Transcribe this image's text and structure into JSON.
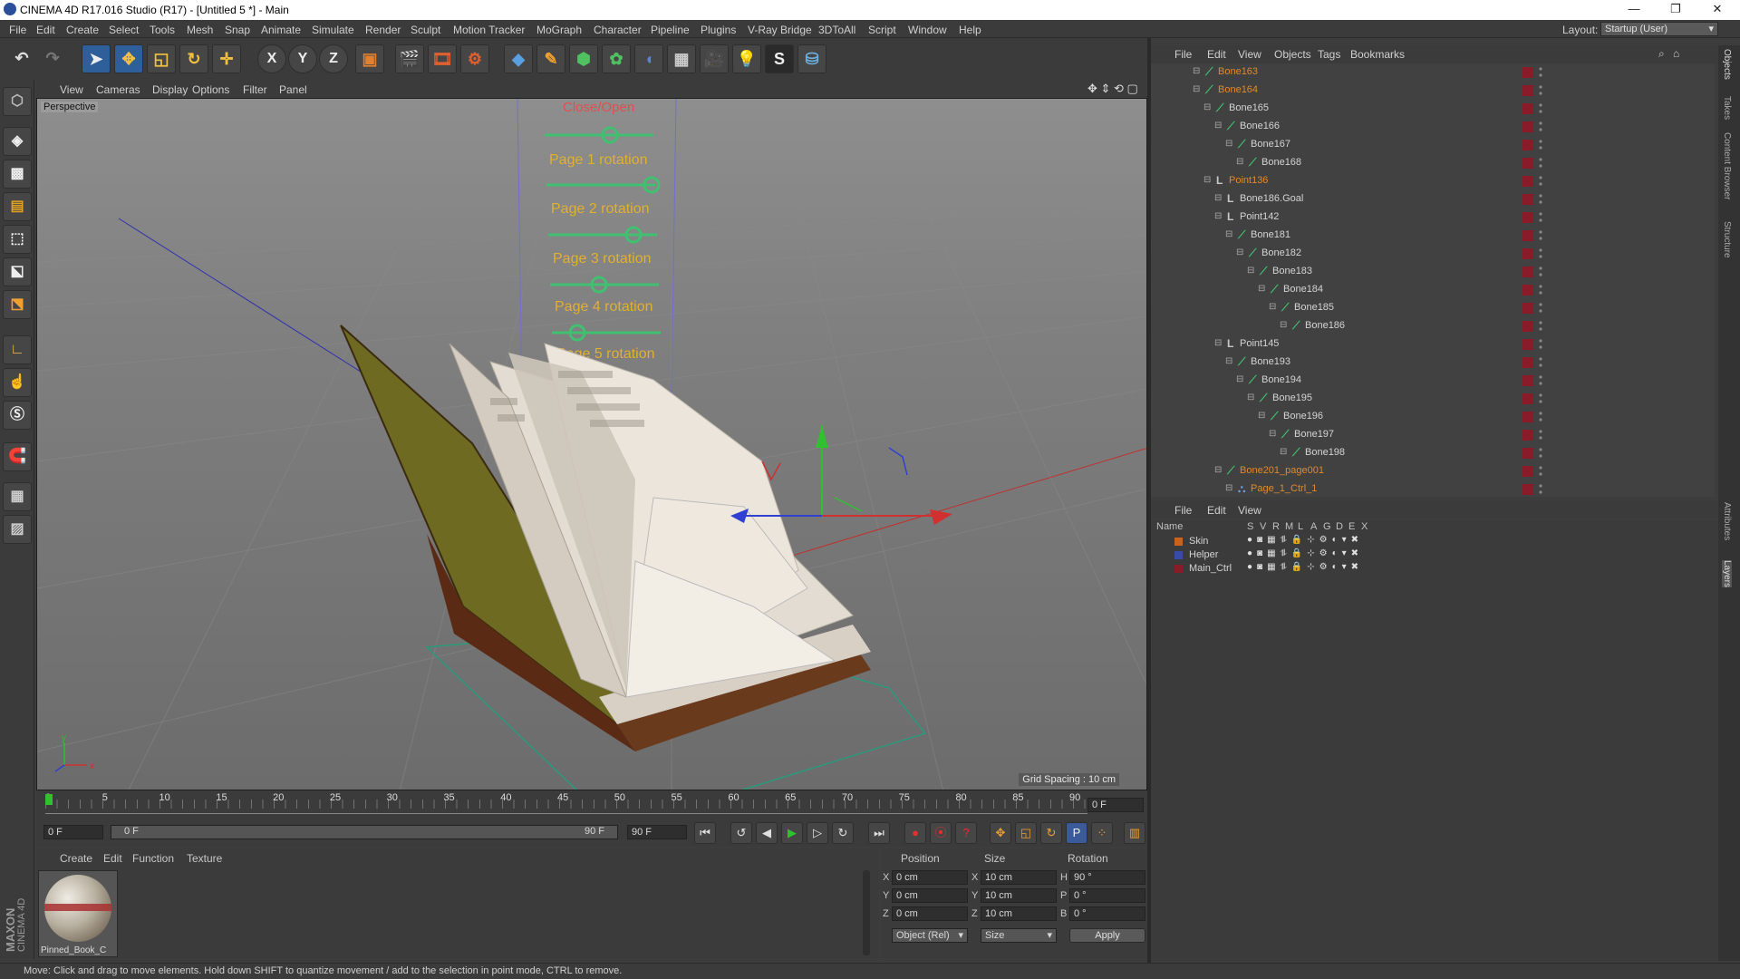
{
  "window": {
    "title": "CINEMA 4D R17.016 Studio (R17) - [Untitled 5 *] - Main",
    "controls": [
      "—",
      "❐",
      "✕"
    ]
  },
  "menubar": {
    "items": [
      "File",
      "Edit",
      "Create",
      "Select",
      "Tools",
      "Mesh",
      "Snap",
      "Animate",
      "Simulate",
      "Render",
      "Sculpt",
      "Motion Tracker",
      "MoGraph",
      "Character",
      "Pipeline",
      "Plugins",
      "V-Ray Bridge",
      "3DToAll",
      "Script",
      "Window",
      "Help"
    ],
    "layout_label": "Layout:",
    "layout_value": "Startup (User)"
  },
  "toolbar": {
    "axis_labels": [
      "X",
      "Y",
      "Z"
    ]
  },
  "viewport": {
    "menu": [
      "View",
      "Cameras",
      "Display",
      "Options",
      "Filter",
      "Panel"
    ],
    "label": "Perspective",
    "grid_spacing": "Grid Spacing : 10 cm",
    "rig_labels": [
      "Close/Open",
      "Page 1 rotation",
      "Page 2 rotation",
      "Page 3 rotation",
      "Page 4 rotation",
      "Page 5 rotation"
    ],
    "axis_x": "x",
    "axis_y": "y"
  },
  "timeline": {
    "ticks": [
      "0",
      "5",
      "10",
      "15",
      "20",
      "25",
      "30",
      "35",
      "40",
      "45",
      "50",
      "55",
      "60",
      "65",
      "70",
      "75",
      "80",
      "85",
      "90"
    ],
    "current_frame": "0 F",
    "playhead_fraction": 0.0
  },
  "playback": {
    "start_field": "0 F",
    "range_start": "0 F",
    "range_end": "90 F",
    "end_field": "90 F"
  },
  "material_manager": {
    "menu": [
      "Create",
      "Edit",
      "Function",
      "Texture"
    ],
    "material_name": "Pinned_Book_C"
  },
  "coordinates": {
    "headers": [
      "Position",
      "Size",
      "Rotation"
    ],
    "rows": [
      {
        "axis": "X",
        "pos": "0 cm",
        "size_axis": "X",
        "size": "10 cm",
        "rot_axis": "H",
        "rot": "90 °"
      },
      {
        "axis": "Y",
        "pos": "0 cm",
        "size_axis": "Y",
        "size": "10 cm",
        "rot_axis": "P",
        "rot": "0 °"
      },
      {
        "axis": "Z",
        "pos": "0 cm",
        "size_axis": "Z",
        "size": "10 cm",
        "rot_axis": "B",
        "rot": "0 °"
      }
    ],
    "mode": "Object (Rel)",
    "size_mode": "Size",
    "apply": "Apply"
  },
  "object_manager": {
    "menu": [
      "File",
      "Edit",
      "View",
      "Objects",
      "Tags",
      "Bookmarks"
    ],
    "objects": [
      {
        "name": "Bone163",
        "orange": true,
        "depth": 3,
        "type": "bone"
      },
      {
        "name": "Bone164",
        "orange": true,
        "depth": 3,
        "type": "bone"
      },
      {
        "name": "Bone165",
        "orange": false,
        "depth": 4,
        "type": "bone"
      },
      {
        "name": "Bone166",
        "orange": false,
        "depth": 5,
        "type": "bone"
      },
      {
        "name": "Bone167",
        "orange": false,
        "depth": 6,
        "type": "bone"
      },
      {
        "name": "Bone168",
        "orange": false,
        "depth": 7,
        "type": "bone"
      },
      {
        "name": "Point136",
        "orange": true,
        "depth": 4,
        "type": "null"
      },
      {
        "name": "Bone186.Goal",
        "orange": false,
        "depth": 5,
        "type": "null"
      },
      {
        "name": "Point142",
        "orange": false,
        "depth": 5,
        "type": "null"
      },
      {
        "name": "Bone181",
        "orange": false,
        "depth": 6,
        "type": "bone"
      },
      {
        "name": "Bone182",
        "orange": false,
        "depth": 7,
        "type": "bone"
      },
      {
        "name": "Bone183",
        "orange": false,
        "depth": 8,
        "type": "bone"
      },
      {
        "name": "Bone184",
        "orange": false,
        "depth": 9,
        "type": "bone"
      },
      {
        "name": "Bone185",
        "orange": false,
        "depth": 10,
        "type": "bone"
      },
      {
        "name": "Bone186",
        "orange": false,
        "depth": 11,
        "type": "bone"
      },
      {
        "name": "Point145",
        "orange": false,
        "depth": 5,
        "type": "null"
      },
      {
        "name": "Bone193",
        "orange": false,
        "depth": 6,
        "type": "bone"
      },
      {
        "name": "Bone194",
        "orange": false,
        "depth": 7,
        "type": "bone"
      },
      {
        "name": "Bone195",
        "orange": false,
        "depth": 8,
        "type": "bone"
      },
      {
        "name": "Bone196",
        "orange": false,
        "depth": 9,
        "type": "bone"
      },
      {
        "name": "Bone197",
        "orange": false,
        "depth": 10,
        "type": "bone"
      },
      {
        "name": "Bone198",
        "orange": false,
        "depth": 11,
        "type": "bone"
      },
      {
        "name": "Bone201_page001",
        "orange": true,
        "depth": 5,
        "type": "bone"
      },
      {
        "name": "Page_1_Ctrl_1",
        "orange": true,
        "depth": 6,
        "type": "ctrl"
      }
    ]
  },
  "layer_manager": {
    "menu": [
      "File",
      "Edit",
      "View"
    ],
    "header": {
      "name": "Name",
      "cols": [
        "S",
        "V",
        "R",
        "M",
        "L",
        "A",
        "G",
        "D",
        "E",
        "X"
      ]
    },
    "layers": [
      {
        "name": "Skin",
        "color": "#c8641e"
      },
      {
        "name": "Helper",
        "color": "#3a4aa8"
      },
      {
        "name": "Main_Ctrl",
        "color": "#8a1c2a"
      }
    ]
  },
  "right_tabs": [
    "Objects",
    "Takes",
    "Content Browser",
    "Structure",
    "Attributes",
    "Layers"
  ],
  "maxon": {
    "line1": "MAXON",
    "line2": "CINEMA 4D"
  },
  "status": "Move: Click and drag to move elements. Hold down SHIFT to quantize movement / add to the selection in point mode, CTRL to remove."
}
